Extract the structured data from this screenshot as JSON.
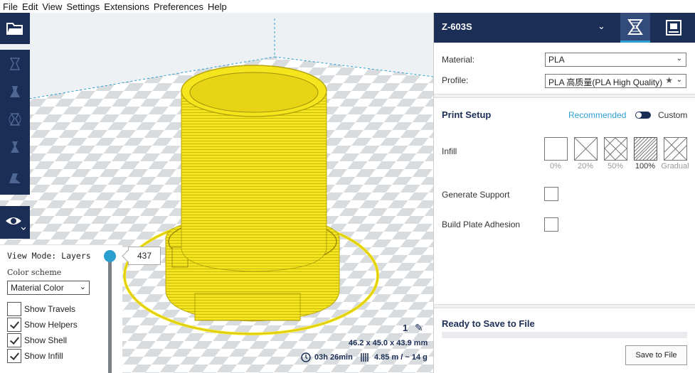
{
  "menu": [
    "File",
    "Edit",
    "View",
    "Settings",
    "Extensions",
    "Preferences",
    "Help"
  ],
  "view_panel": {
    "title": "View Mode: Layers",
    "color_scheme_label": "Color scheme",
    "color_scheme_value": "Material Color",
    "checks": [
      {
        "label": "Show Travels",
        "checked": false
      },
      {
        "label": "Show Helpers",
        "checked": true
      },
      {
        "label": "Show Shell",
        "checked": true
      },
      {
        "label": "Show Infill",
        "checked": true
      }
    ]
  },
  "layer": {
    "current": "437"
  },
  "job": {
    "count": "1",
    "dimensions": "46.2 x 45.0 x 43.9 mm",
    "time": "03h 26min",
    "usage": "4.85 m / ~ 14 g"
  },
  "sidebar": {
    "printer": "Z-603S",
    "material_label": "Material:",
    "material_value": "PLA",
    "profile_label": "Profile:",
    "profile_value": "PLA 高质量(PLA High Quality)",
    "print_setup": "Print Setup",
    "recommended": "Recommended",
    "custom": "Custom",
    "infill_label": "Infill",
    "infill_options": [
      "0%",
      "20%",
      "50%",
      "100%",
      "Gradual"
    ],
    "infill_selected": "100%",
    "support_label": "Generate Support",
    "adhesion_label": "Build Plate Adhesion",
    "ready": "Ready to Save to File",
    "save_button": "Save to File"
  },
  "colors": {
    "accent": "#2a9fd0",
    "navy": "#1b2e56",
    "model_yellow": "#f5e51d"
  }
}
